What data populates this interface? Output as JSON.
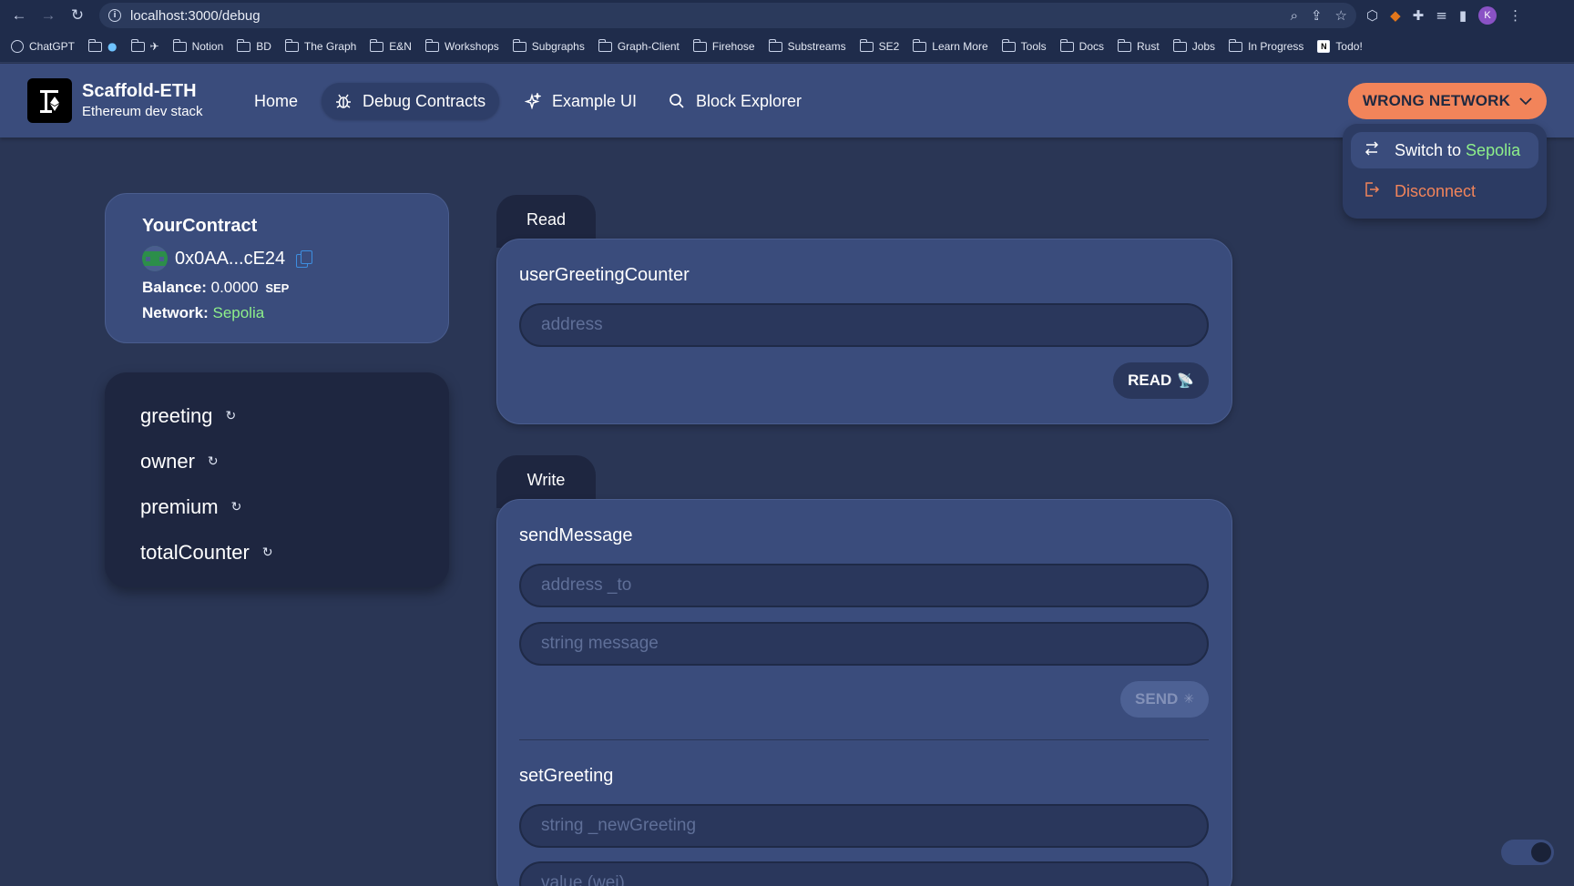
{
  "browser": {
    "url": "localhost:3000/debug",
    "bookmarks": [
      "ChatGPT",
      "",
      "",
      "Notion",
      "BD",
      "The Graph",
      "E&N",
      "Workshops",
      "Subgraphs",
      "Graph-Client",
      "Firehose",
      "Substreams",
      "SE2",
      "Learn More",
      "Tools",
      "Docs",
      "Rust",
      "Jobs",
      "In Progress",
      "Todo!"
    ],
    "profile_initial": "K"
  },
  "header": {
    "brand_title": "Scaffold-ETH",
    "brand_subtitle": "Ethereum dev stack",
    "nav": {
      "home": "Home",
      "debug": "Debug Contracts",
      "example": "Example UI",
      "explorer": "Block Explorer"
    },
    "network_button": "WRONG NETWORK",
    "accent": "#f2845a"
  },
  "network_menu": {
    "switch_prefix": "Switch to",
    "switch_network": "Sepolia",
    "disconnect": "Disconnect"
  },
  "contract": {
    "name": "YourContract",
    "address": "0x0AA...cE24",
    "balance_label": "Balance:",
    "balance_value": "0.0000",
    "balance_currency": "SEP",
    "network_label": "Network",
    "network_value": "Sepolia"
  },
  "functions": [
    "greeting",
    "owner",
    "premium",
    "totalCounter"
  ],
  "read_panel": {
    "tab": "Read",
    "function_name": "userGreetingCounter",
    "input_placeholder": "address",
    "button": "READ"
  },
  "write_panel": {
    "tab": "Write",
    "send_message": {
      "name": "sendMessage",
      "input1": "address _to",
      "input2": "string message",
      "button": "SEND"
    },
    "set_greeting": {
      "name": "setGreeting",
      "input1": "string _newGreeting",
      "input2": "value (wei)"
    }
  }
}
